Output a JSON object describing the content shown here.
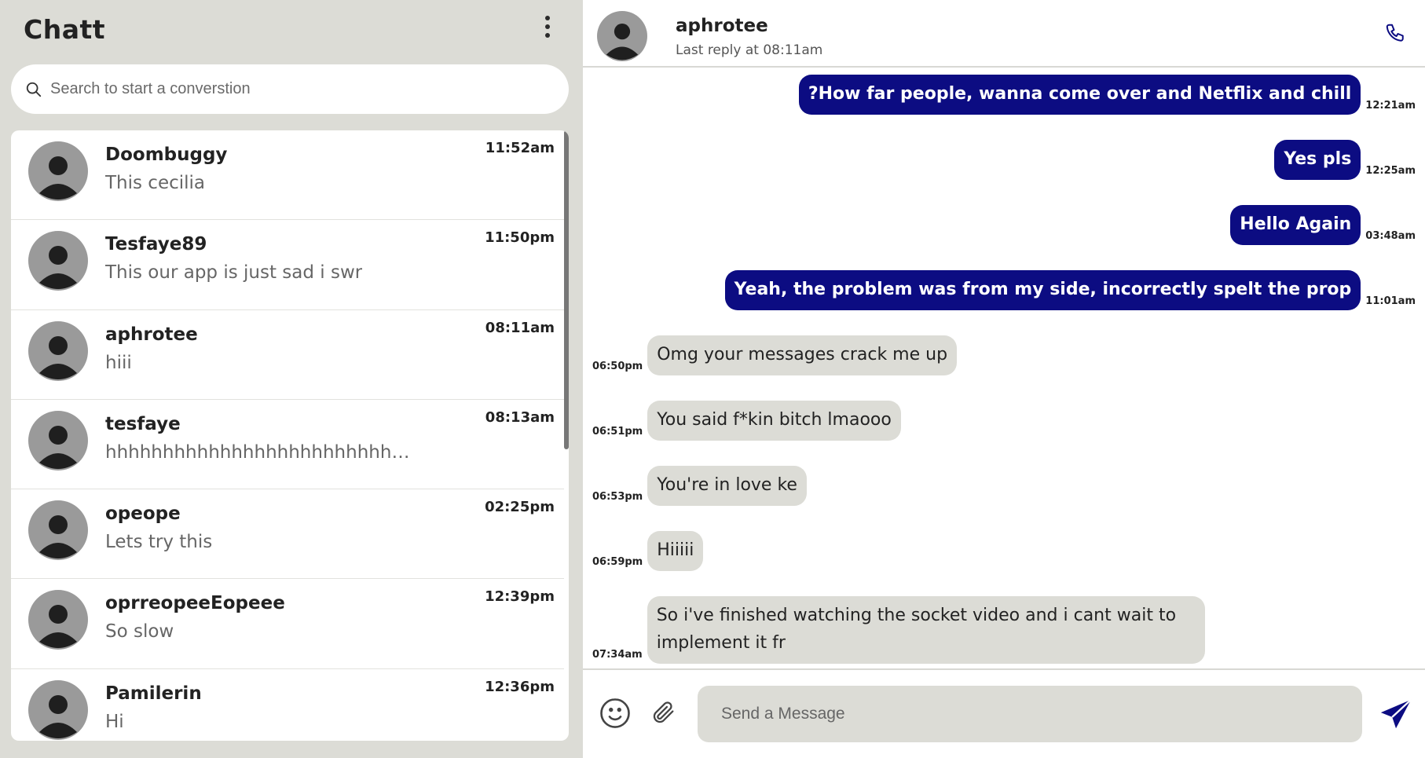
{
  "app": {
    "title": "Chatt"
  },
  "search": {
    "placeholder": "Search to start a converstion"
  },
  "conversations": [
    {
      "name": "Doombuggy",
      "preview": "This cecilia",
      "time": "11:52am"
    },
    {
      "name": "Tesfaye89",
      "preview": "This our app is just sad i swr",
      "time": "11:50pm"
    },
    {
      "name": "aphrotee",
      "preview": "hiii",
      "time": "08:11am"
    },
    {
      "name": "tesfaye",
      "preview": "hhhhhhhhhhhhhhhhhhhhhhhhhhhhhhhhhhhh",
      "time": "08:13am"
    },
    {
      "name": "opeope",
      "preview": "Lets try this",
      "time": "02:25pm"
    },
    {
      "name": "oprreopeeEopeee",
      "preview": "So slow",
      "time": "12:39pm"
    },
    {
      "name": "Pamilerin",
      "preview": "Hi",
      "time": "12:36pm"
    }
  ],
  "chat": {
    "name": "aphrotee",
    "status": "Last reply at 08:11am",
    "messages": [
      {
        "direction": "out",
        "text": "?How far people, wanna come over and Netflix and chill",
        "time": "12:21am"
      },
      {
        "direction": "out",
        "text": "Yes pls",
        "time": "12:25am"
      },
      {
        "direction": "out",
        "text": "Hello Again",
        "time": "03:48am"
      },
      {
        "direction": "out",
        "text": "Yeah, the problem was from my side, incorrectly spelt the prop",
        "time": "11:01am"
      },
      {
        "direction": "in",
        "text": "Omg your messages crack me up",
        "time": "06:50pm"
      },
      {
        "direction": "in",
        "text": "You said f*kin bitch lmaooo",
        "time": "06:51pm"
      },
      {
        "direction": "in",
        "text": "You're in love ke",
        "time": "06:53pm"
      },
      {
        "direction": "in",
        "text": "Hiiiii",
        "time": "06:59pm"
      },
      {
        "direction": "in",
        "text": "So i've finished watching the socket video and i cant wait to implement it fr",
        "time": "07:34am"
      }
    ]
  },
  "composer": {
    "placeholder": "Send a Message"
  },
  "icons": {
    "menu": "more-vertical-icon",
    "search": "search-icon",
    "avatar": "user-avatar-icon",
    "phone": "phone-icon",
    "emoji": "emoji-icon",
    "attach": "paperclip-icon",
    "send": "send-icon"
  },
  "colors": {
    "sidebar_bg": "#dcdcd6",
    "outgoing_bubble": "#0c0c82",
    "incoming_bubble": "#dcdcd6",
    "accent": "#0c0c82"
  }
}
